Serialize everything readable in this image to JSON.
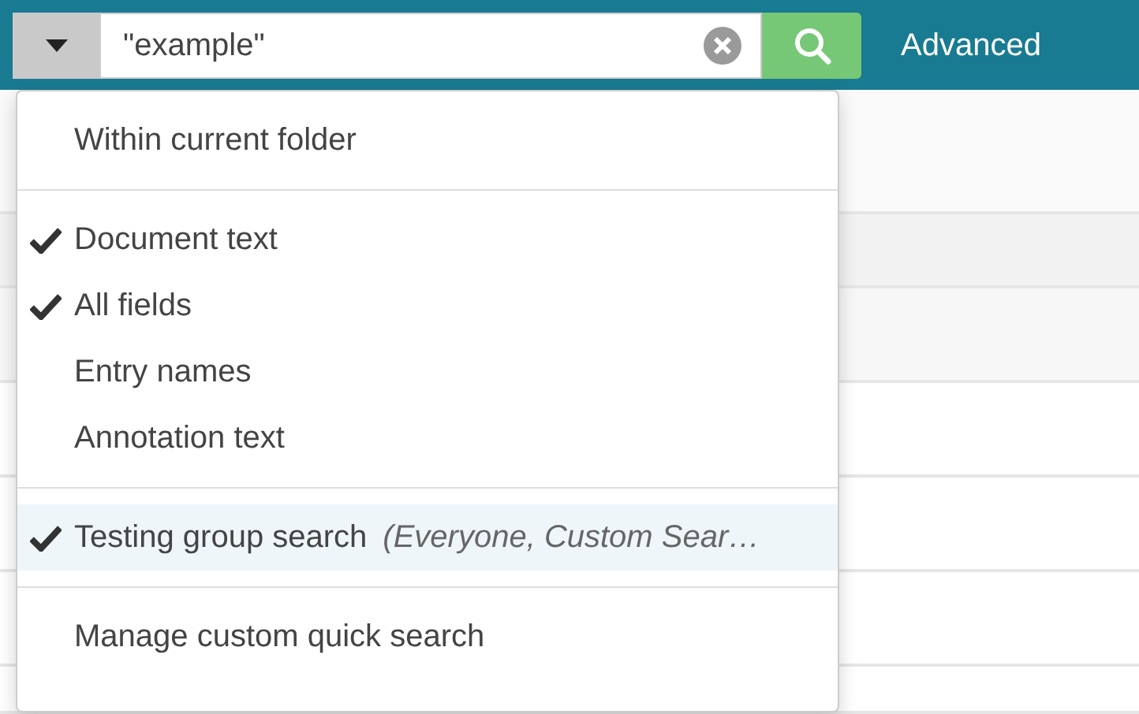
{
  "search": {
    "value": "\"example\"",
    "advanced_link": "Advanced"
  },
  "menu": {
    "sections": [
      {
        "items": [
          {
            "label": "Within current folder",
            "checked": false,
            "selected": false
          }
        ]
      },
      {
        "items": [
          {
            "label": "Document text",
            "checked": true,
            "selected": false
          },
          {
            "label": "All fields",
            "checked": true,
            "selected": false
          },
          {
            "label": "Entry names",
            "checked": false,
            "selected": false
          },
          {
            "label": "Annotation text",
            "checked": false,
            "selected": false
          }
        ]
      },
      {
        "items": [
          {
            "label": "Testing group search",
            "detail": "(Everyone, Custom Sear…",
            "checked": true,
            "selected": true
          }
        ]
      },
      {
        "items": [
          {
            "label": "Manage custom quick search",
            "checked": false,
            "selected": false
          }
        ]
      }
    ]
  }
}
